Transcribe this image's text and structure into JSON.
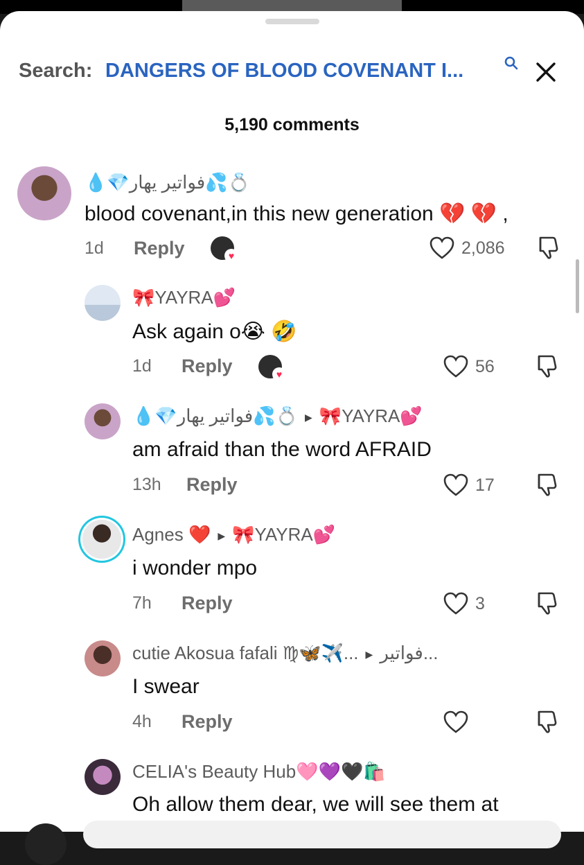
{
  "search": {
    "label": "Search:",
    "term": "DANGERS OF BLOOD COVENANT I..."
  },
  "comments_count": "5,190 comments",
  "comments": [
    {
      "name": "💧💎فواتير يهار💦💍",
      "body": "blood covenant,in this new generation 💔 💔 ,",
      "time": "1d",
      "reply": "Reply",
      "likes": "2,086"
    },
    {
      "name": "🎀YAYRA💕",
      "body": "Ask again o😭 🤣",
      "time": "1d",
      "reply": "Reply",
      "likes": "56"
    },
    {
      "name": "💧💎فواتير يهار💦💍",
      "reply_to": "🎀YAYRA💕",
      "body": "am afraid than the word AFRAID",
      "time": "13h",
      "reply": "Reply",
      "likes": "17"
    },
    {
      "name": "Agnes ❤️",
      "reply_to": "🎀YAYRA💕",
      "body": "i wonder mpo",
      "time": "7h",
      "reply": "Reply",
      "likes": "3"
    },
    {
      "name": "cutie Akosua fafali ♍🦋✈️...",
      "reply_to": "فواتير...",
      "body": "I swear",
      "time": "4h",
      "reply": "Reply",
      "likes": ""
    },
    {
      "name": "CELIA's Beauty Hub🩷💜🖤🛍️",
      "body": "Oh allow them dear, we will see them at"
    }
  ],
  "colors": {
    "accent": "#2a64c0",
    "heart_red": "#ff2d55",
    "ring": "#22c6e0"
  },
  "icons": [
    "search-icon",
    "close-icon",
    "heart-icon",
    "dislike-icon",
    "reply-arrow-icon"
  ]
}
